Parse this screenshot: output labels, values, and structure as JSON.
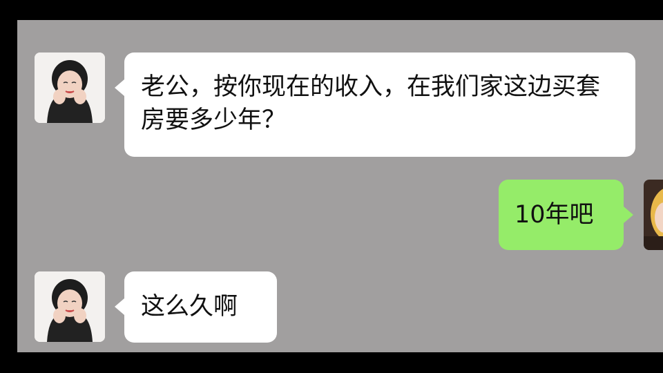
{
  "chat": {
    "messages": [
      {
        "sender": "other",
        "text": "老公，按你现在的收入，在我们家这边买套房要多少年？"
      },
      {
        "sender": "self",
        "text": "10年吧"
      },
      {
        "sender": "other",
        "text": "这么久啊"
      }
    ]
  },
  "colors": {
    "background": "#a19f9f",
    "incoming_bubble": "#ffffff",
    "outgoing_bubble": "#95ec69",
    "frame": "#000000"
  }
}
